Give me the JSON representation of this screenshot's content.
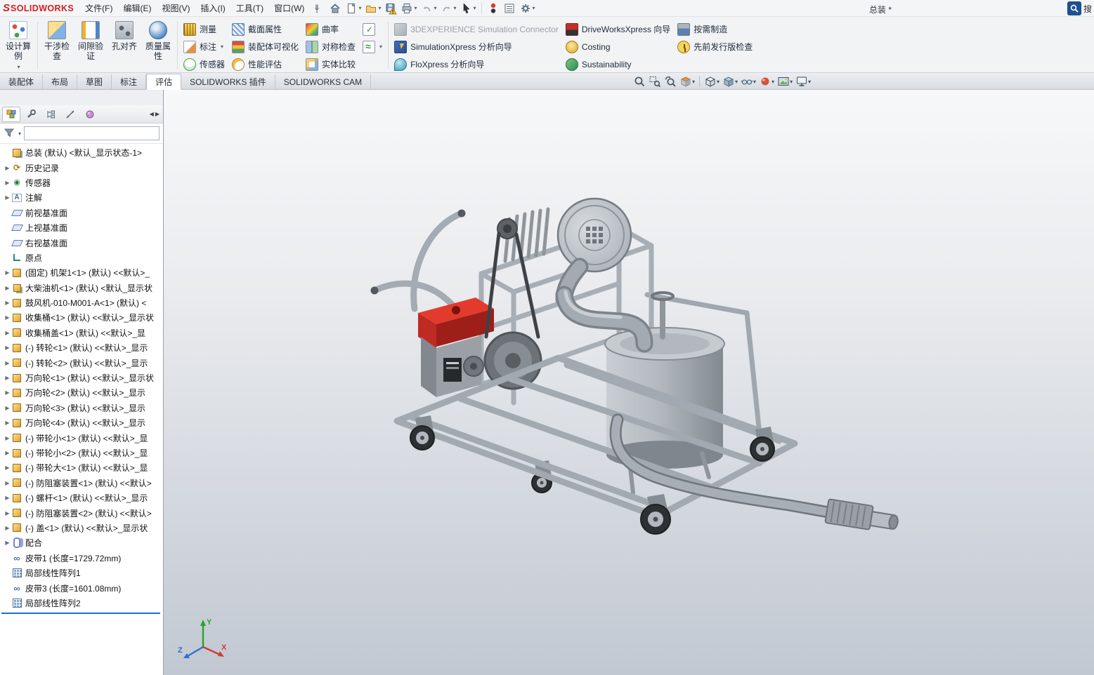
{
  "colors": {
    "accent_blue": "#1b6fd0",
    "logo_red": "#cf2027",
    "viewport_top": "#f7f8f9",
    "viewport_bottom": "#c2c8d2"
  },
  "menubar": {
    "logo": "SOLIDWORKS",
    "logo_mark": "S",
    "menus": [
      "文件(F)",
      "编辑(E)",
      "视图(V)",
      "插入(I)",
      "工具(T)",
      "窗口(W)"
    ],
    "doc_title": "总装 *",
    "search_label": "搜"
  },
  "ribbon": {
    "tall": [
      {
        "label": "设计算例"
      },
      {
        "label": "干涉检查"
      },
      {
        "label": "间隙验证"
      },
      {
        "label": "孔对齐"
      },
      {
        "label": "质量属性"
      }
    ],
    "col1": [
      {
        "label": "测量"
      },
      {
        "label": "标注"
      },
      {
        "label": "传感器"
      }
    ],
    "col2": [
      {
        "label": "截面属性"
      },
      {
        "label": "装配体可视化"
      },
      {
        "label": "性能评估"
      }
    ],
    "col3": [
      {
        "label": "曲率"
      },
      {
        "label": "对称检查"
      },
      {
        "label": "实体比较"
      }
    ],
    "col4": [
      {
        "label": "3DEXPERIENCE Simulation Connector",
        "disabled": true
      },
      {
        "label": "SimulationXpress 分析向导"
      },
      {
        "label": "FloXpress 分析向导"
      }
    ],
    "col5": [
      {
        "label": "DriveWorksXpress 向导"
      },
      {
        "label": "Costing"
      },
      {
        "label": "Sustainability"
      }
    ],
    "col6": [
      {
        "label": "按需制造"
      },
      {
        "label": "先前发行版检查"
      }
    ]
  },
  "tabs": {
    "items": [
      "装配体",
      "布局",
      "草图",
      "标注",
      "评估",
      "SOLIDWORKS 插件",
      "SOLIDWORKS CAM"
    ],
    "active": "评估"
  },
  "panel": {
    "filter_placeholder": ""
  },
  "tree": {
    "items": [
      {
        "label": "总装 (默认) <默认_显示状态-1>",
        "icon": "root",
        "arrow": false
      },
      {
        "label": "历史记录",
        "icon": "history",
        "arrow": true
      },
      {
        "label": "传感器",
        "icon": "sensor",
        "arrow": true
      },
      {
        "label": "注解",
        "icon": "annotation",
        "arrow": true
      },
      {
        "label": "前视基准面",
        "icon": "plane",
        "arrow": false
      },
      {
        "label": "上视基准面",
        "icon": "plane",
        "arrow": false
      },
      {
        "label": "右视基准面",
        "icon": "plane",
        "arrow": false
      },
      {
        "label": "原点",
        "icon": "origin",
        "arrow": false
      },
      {
        "label": "(固定) 机架1<1> (默认) <<默认>_",
        "icon": "part",
        "arrow": true
      },
      {
        "label": "大柴油机<1> (默认) <默认_显示状",
        "icon": "asm",
        "arrow": true
      },
      {
        "label": "鼓风机-010-M001-A<1> (默认) <",
        "icon": "part",
        "arrow": true
      },
      {
        "label": "收集桶<1> (默认) <<默认>_显示状",
        "icon": "part",
        "arrow": true
      },
      {
        "label": "收集桶盖<1> (默认) <<默认>_显",
        "icon": "part",
        "arrow": true
      },
      {
        "label": "(-) 转轮<1> (默认) <<默认>_显示",
        "icon": "part",
        "arrow": true
      },
      {
        "label": "(-) 转轮<2> (默认) <<默认>_显示",
        "icon": "part",
        "arrow": true
      },
      {
        "label": "万向轮<1> (默认) <<默认>_显示状",
        "icon": "part",
        "arrow": true
      },
      {
        "label": "万向轮<2> (默认) <<默认>_显示",
        "icon": "part",
        "arrow": true
      },
      {
        "label": "万向轮<3> (默认) <<默认>_显示",
        "icon": "part",
        "arrow": true
      },
      {
        "label": "万向轮<4> (默认) <<默认>_显示",
        "icon": "part",
        "arrow": true
      },
      {
        "label": "(-) 带轮小<1> (默认) <<默认>_显",
        "icon": "part",
        "arrow": true
      },
      {
        "label": "(-) 带轮小<2> (默认) <<默认>_显",
        "icon": "part",
        "arrow": true
      },
      {
        "label": "(-) 带轮大<1> (默认) <<默认>_显",
        "icon": "part",
        "arrow": true
      },
      {
        "label": "(-) 防阻塞装置<1> (默认) <<默认>",
        "icon": "part",
        "arrow": true
      },
      {
        "label": "(-) 螺杆<1> (默认) <<默认>_显示",
        "icon": "part",
        "arrow": true
      },
      {
        "label": "(-) 防阻塞装置<2> (默认) <<默认>",
        "icon": "part",
        "arrow": true
      },
      {
        "label": "(-) 盖<1> (默认) <<默认>_显示状",
        "icon": "part",
        "arrow": true
      },
      {
        "label": "配合",
        "icon": "mates",
        "arrow": true
      },
      {
        "label": "皮带1 (长度=1729.72mm)",
        "icon": "belt",
        "arrow": false
      },
      {
        "label": "局部线性阵列1",
        "icon": "pattern",
        "arrow": false
      },
      {
        "label": "皮带3 (长度=1601.08mm)",
        "icon": "belt",
        "arrow": false
      },
      {
        "label": "局部线性阵列2",
        "icon": "pattern",
        "arrow": false
      }
    ]
  },
  "viewport": {
    "triad": {
      "x": "X",
      "y": "Y",
      "z": "Z"
    },
    "hud_icons": [
      "zoom-fit",
      "zoom-area",
      "previous-view",
      "section-view",
      "view-orientation",
      "display-style",
      "hide-show-items",
      "edit-appearance",
      "apply-scene",
      "view-settings"
    ]
  }
}
